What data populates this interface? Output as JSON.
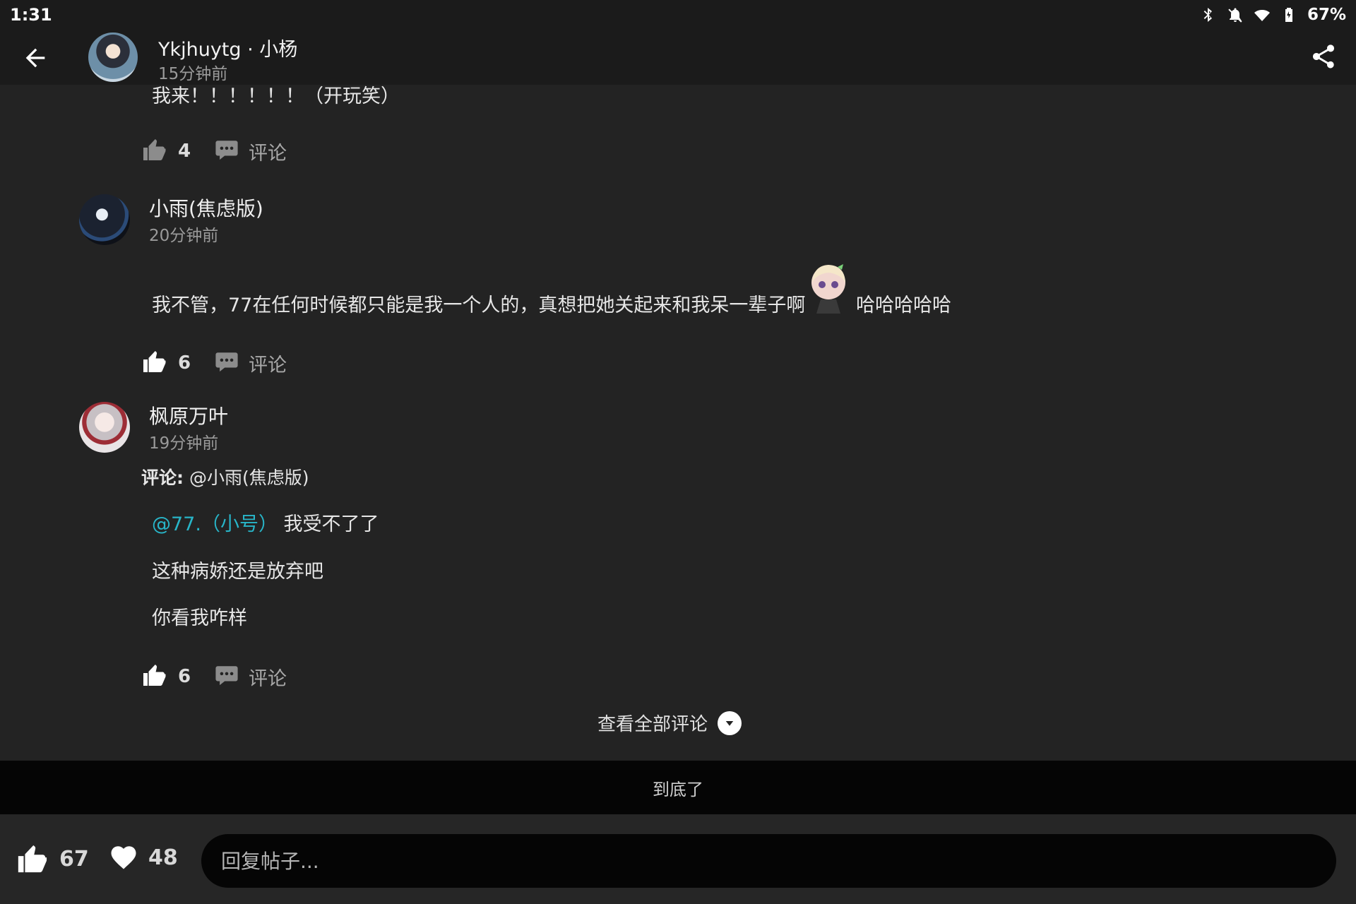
{
  "status_bar": {
    "time": "1:31",
    "battery": "67%"
  },
  "header": {
    "author": "Ykjhuytg · 小杨",
    "time": "15分钟前"
  },
  "comments": [
    {
      "text": "我来！！！！！！（开玩笑）",
      "likes": "4",
      "comment_label": "评论",
      "like_icon": "thumb-up-outline-icon"
    },
    {
      "name": "小雨(焦虑版)",
      "time": "20分钟前",
      "text_before": "我不管，77在任何时候都只能是我一个人的，真想把她关起来和我呆一辈子啊",
      "text_after": "哈哈哈哈哈",
      "likes": "6",
      "comment_label": "评论",
      "like_icon": "thumb-up-filled-icon"
    },
    {
      "name": "枫原万叶",
      "time": "19分钟前",
      "reply_prefix": "评论:",
      "reply_target": "@小雨(焦虑版)",
      "mention": "@77.（小号）",
      "line1": "我受不了了",
      "line2": "这种病娇还是放弃吧",
      "line3": "你看我咋样",
      "likes": "6",
      "comment_label": "评论",
      "like_icon": "thumb-up-filled-icon"
    }
  ],
  "view_all": "查看全部评论",
  "end_text": "到底了",
  "bottom": {
    "likes": "67",
    "favorites": "48",
    "reply_placeholder": "回复帖子..."
  },
  "colors": {
    "background": "#232323",
    "mention": "#28b5c8"
  }
}
